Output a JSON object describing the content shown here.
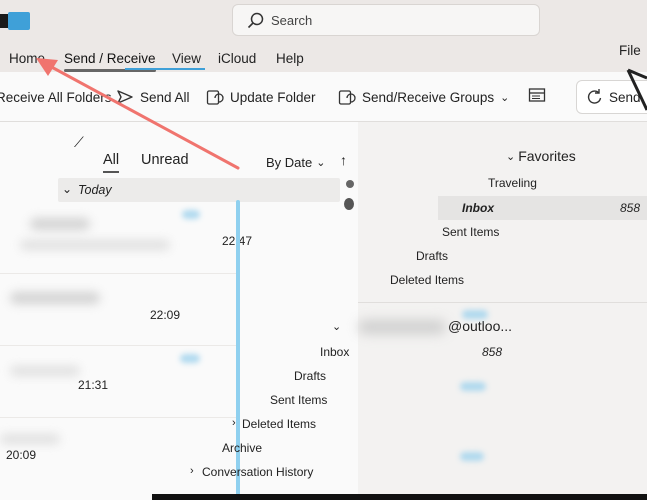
{
  "search": {
    "placeholder": "Search"
  },
  "menu": {
    "file": "File",
    "tabs": [
      {
        "label": "Home"
      },
      {
        "label": "Send / Receive"
      },
      {
        "label": "View"
      },
      {
        "label": "iCloud"
      },
      {
        "label": "Help"
      }
    ]
  },
  "ribbon": {
    "receive_all": "Receive All Folders",
    "send_all": "Send All",
    "update_folder": "Update Folder",
    "groups": "Send/Receive Groups",
    "send_right": "Send"
  },
  "list": {
    "filter_all": "All",
    "filter_unread": "Unread",
    "sort_label": "By Date",
    "group_label": "Today",
    "times": [
      "22:47",
      "22:09",
      "21:31",
      "20:09"
    ]
  },
  "folders": {
    "favorites_label": "Favorites",
    "fav": [
      "Traveling",
      "Inbox",
      "Sent Items",
      "Drafts",
      "Deleted Items"
    ],
    "inbox_count": "858",
    "account_name": "@outloo...",
    "account_items": [
      "Inbox",
      "Drafts",
      "Sent Items",
      "Deleted Items",
      "Archive",
      "Conversation History"
    ],
    "account_inbox_count": "858"
  },
  "colors": {
    "accent": "#3fa0d8",
    "annotation_arrow": "#f0746e",
    "selection": "#e5e4e3"
  }
}
